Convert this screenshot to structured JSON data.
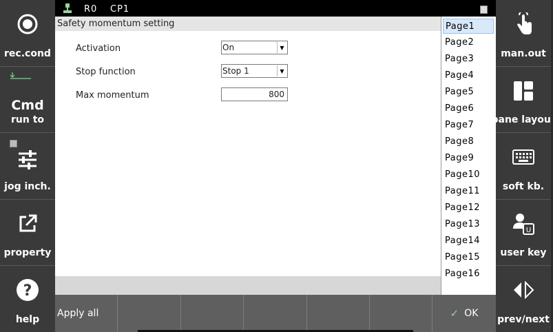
{
  "status": {
    "r0": "R0",
    "cp": "CP1"
  },
  "left_panel": {
    "buttons": [
      {
        "label": "rec.cond",
        "icon": "record-circle-icon"
      },
      {
        "big": "Cmd",
        "label": "run to",
        "icon": "run-to-arrow-icon"
      },
      {
        "label": "jog inch.",
        "icon": "sliders-icon"
      },
      {
        "label": "property",
        "icon": "external-link-icon"
      },
      {
        "label": "help",
        "icon": "help-icon"
      }
    ]
  },
  "right_panel": {
    "buttons": [
      {
        "label": "man.out",
        "icon": "touch-hand-icon"
      },
      {
        "label": "pane layout",
        "icon": "pane-layout-icon"
      },
      {
        "label": "soft kb.",
        "icon": "keyboard-icon"
      },
      {
        "label": "user key",
        "icon": "user-key-icon"
      },
      {
        "label": "prev/next",
        "icon": "prev-next-icon"
      }
    ]
  },
  "main": {
    "title": "Safety momentum setting",
    "fields": {
      "activation": {
        "label": "Activation",
        "value": "On"
      },
      "stop_function": {
        "label": "Stop function",
        "value": "Stop 1"
      },
      "max_momentum": {
        "label": "Max momentum",
        "value": "800"
      }
    }
  },
  "pages": {
    "items": [
      "Page1",
      "Page2",
      "Page3",
      "Page4",
      "Page5",
      "Page6",
      "Page7",
      "Page8",
      "Page9",
      "Page10",
      "Page11",
      "Page12",
      "Page13",
      "Page14",
      "Page15",
      "Page16"
    ],
    "selected": "Page1"
  },
  "bottom": {
    "apply_all": "Apply all",
    "ok": "OK"
  }
}
